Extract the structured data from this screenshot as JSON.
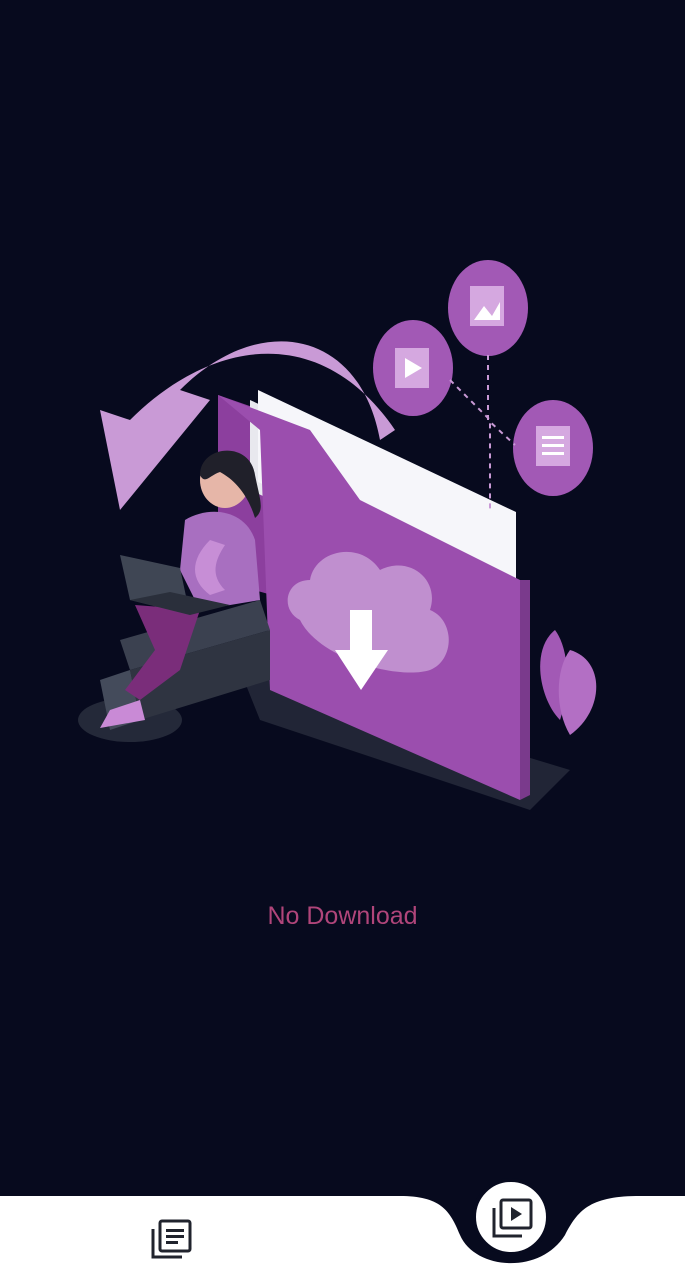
{
  "empty_state": {
    "message": "No Download",
    "message_color": "#b0457a"
  },
  "colors": {
    "background": "#070a1e",
    "accent_purple": "#a259b5",
    "nav_bar": "#ffffff"
  },
  "bottom_nav": {
    "items": [
      {
        "icon": "list-icon",
        "selected": false
      },
      {
        "icon": "video-library-icon",
        "selected": true
      }
    ]
  }
}
